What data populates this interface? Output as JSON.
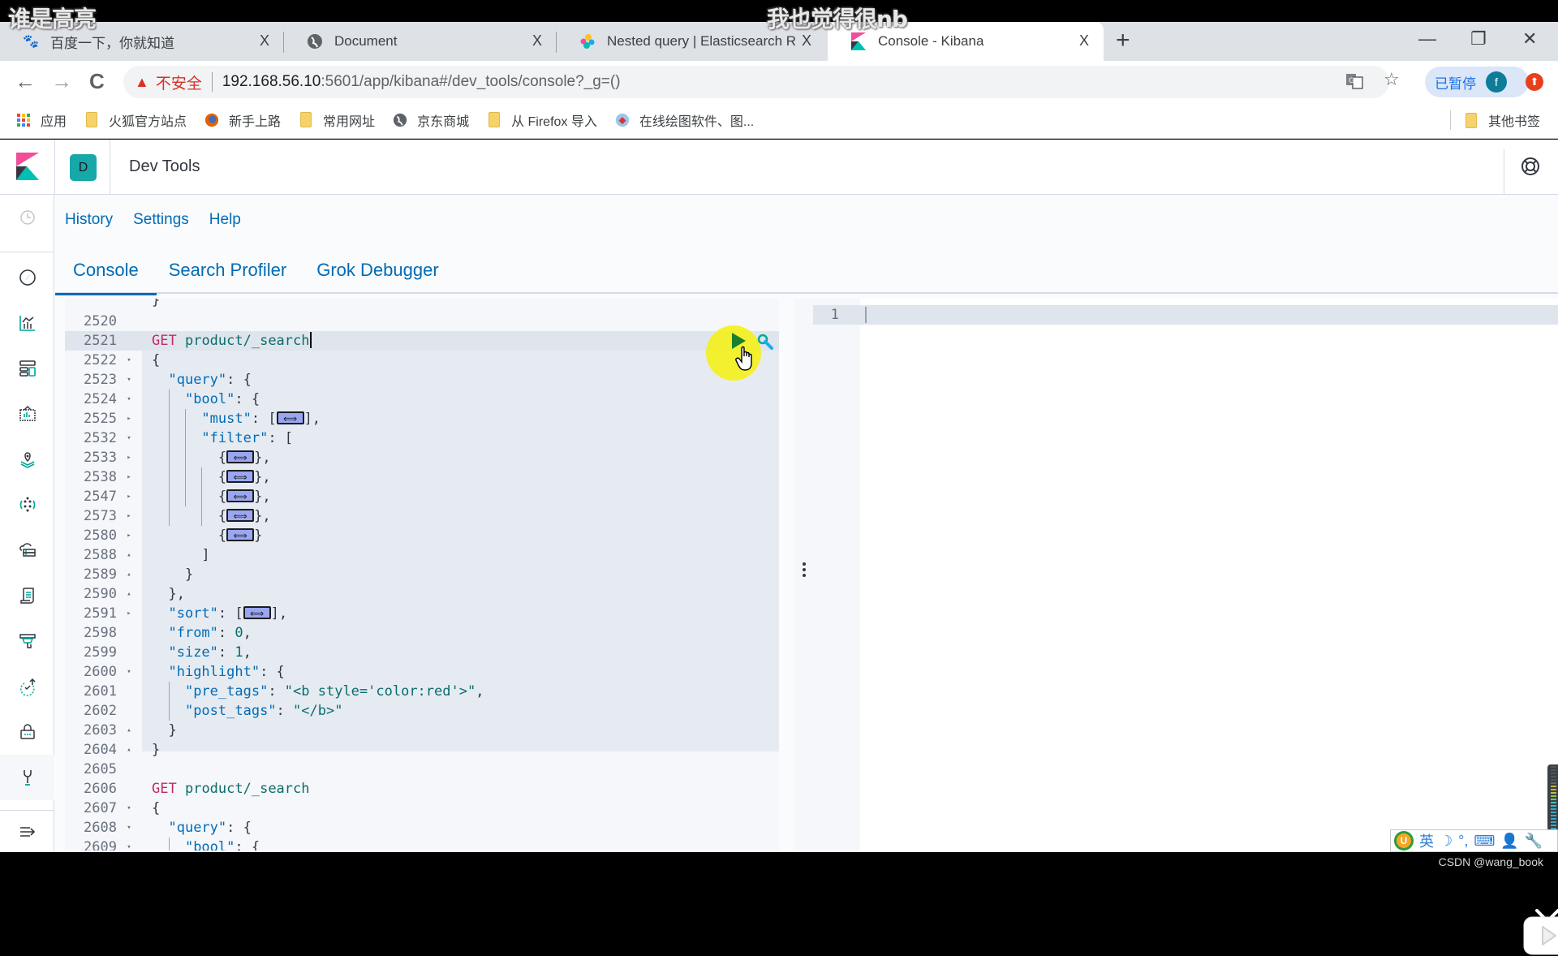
{
  "overlay": {
    "watermark_left": "谁是高亮",
    "watermark_right": "我也觉得很nb",
    "credit": "CSDN @wang_book"
  },
  "browser": {
    "tabs": [
      {
        "title": "百度一下，你就知道",
        "icon": "baidu-paw-icon",
        "active": false
      },
      {
        "title": "Document",
        "icon": "globe-icon",
        "active": false
      },
      {
        "title": "Nested query | Elasticsearch R",
        "icon": "elastic-icon",
        "active": false
      },
      {
        "title": "Console - Kibana",
        "icon": "kibana-icon",
        "active": true
      }
    ],
    "close_glyph": "X",
    "new_tab_glyph": "+",
    "window_controls": {
      "minimize": "—",
      "restore": "❐",
      "close": "✕"
    },
    "nav": {
      "back": "←",
      "forward": "→",
      "reload": "C"
    },
    "address": {
      "security_label": "不安全",
      "host": "192.168.56.10",
      "path": ":5601/app/kibana#/dev_tools/console?_g=()"
    },
    "profile": {
      "paused_label": "已暂停",
      "avatar_letter": "f"
    },
    "bookmarks": [
      {
        "label": "应用",
        "icon": "apps-grid-icon"
      },
      {
        "label": "火狐官方站点",
        "icon": "folder-icon"
      },
      {
        "label": "新手上路",
        "icon": "firefox-icon"
      },
      {
        "label": "常用网址",
        "icon": "folder-icon"
      },
      {
        "label": "京东商城",
        "icon": "globe-icon"
      },
      {
        "label": "从 Firefox 导入",
        "icon": "folder-icon"
      },
      {
        "label": "在线绘图软件、图...",
        "icon": "drawio-icon"
      }
    ],
    "other_bookmarks": "其他书签"
  },
  "kibana": {
    "space_letter": "D",
    "app_title": "Dev Tools",
    "subnav": [
      "History",
      "Settings",
      "Help"
    ],
    "tabs": [
      {
        "label": "Console",
        "active": true
      },
      {
        "label": "Search Profiler",
        "active": false
      },
      {
        "label": "Grok Debugger",
        "active": false
      }
    ],
    "sidenav": [
      "recently-viewed",
      "discover",
      "visualize",
      "dashboard",
      "canvas",
      "maps",
      "machine-learning",
      "infrastructure",
      "logs",
      "apm",
      "uptime",
      "siem",
      "dev-tools",
      "collapse"
    ],
    "editor": {
      "lines": [
        {
          "n": "2520",
          "fold": ""
        },
        {
          "n": "2521",
          "fold": ""
        },
        {
          "n": "2522",
          "fold": "▾"
        },
        {
          "n": "2523",
          "fold": "▾"
        },
        {
          "n": "2524",
          "fold": "▾"
        },
        {
          "n": "2525",
          "fold": "▸"
        },
        {
          "n": "2532",
          "fold": "▾"
        },
        {
          "n": "2533",
          "fold": "▸"
        },
        {
          "n": "2538",
          "fold": "▸"
        },
        {
          "n": "2547",
          "fold": "▸"
        },
        {
          "n": "2573",
          "fold": "▸"
        },
        {
          "n": "2580",
          "fold": "▸"
        },
        {
          "n": "2588",
          "fold": "▴"
        },
        {
          "n": "2589",
          "fold": "▴"
        },
        {
          "n": "2590",
          "fold": "▴"
        },
        {
          "n": "2591",
          "fold": "▸"
        },
        {
          "n": "2598",
          "fold": ""
        },
        {
          "n": "2599",
          "fold": ""
        },
        {
          "n": "2600",
          "fold": "▾"
        },
        {
          "n": "2601",
          "fold": ""
        },
        {
          "n": "2602",
          "fold": ""
        },
        {
          "n": "2603",
          "fold": "▴"
        },
        {
          "n": "2604",
          "fold": "▴"
        },
        {
          "n": "2605",
          "fold": ""
        },
        {
          "n": "2606",
          "fold": ""
        },
        {
          "n": "2607",
          "fold": "▾"
        },
        {
          "n": "2608",
          "fold": "▾"
        },
        {
          "n": "2609",
          "fold": "▾"
        }
      ],
      "tokens": {
        "method": "GET",
        "endpoint": "product/_search",
        "query": "\"query\"",
        "bool": "\"bool\"",
        "must": "\"must\"",
        "filter": "\"filter\"",
        "sort": "\"sort\"",
        "from": "\"from\"",
        "from_val": "0",
        "size": "\"size\"",
        "size_val": "1",
        "highlight": "\"highlight\"",
        "pre_tags": "\"pre_tags\"",
        "pre_tags_val": "\"<b style='color:red'>\"",
        "post_tags": "\"post_tags\"",
        "post_tags_val": "\"</b>\""
      }
    },
    "output": {
      "line_number": "1"
    }
  },
  "taskbar": {
    "ime_lang": "英"
  }
}
